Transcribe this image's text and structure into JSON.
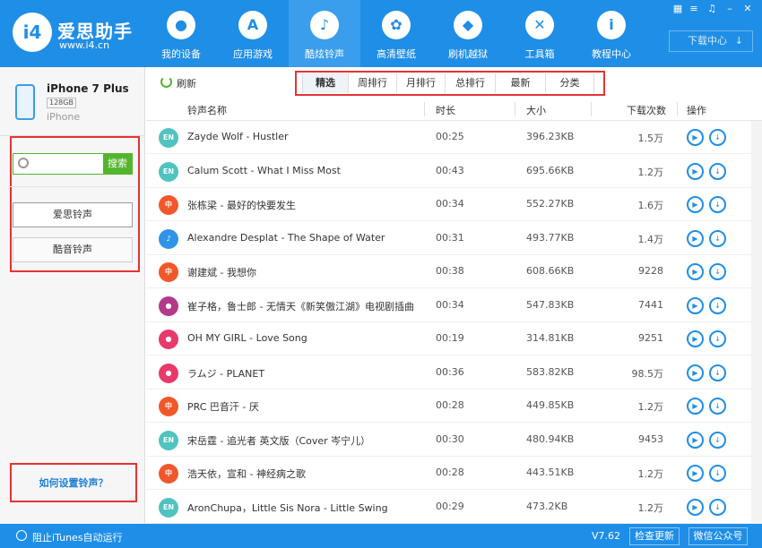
{
  "header": {
    "logo_text": "爱思助手",
    "logo_mark": "i4",
    "logo_url": "www.i4.cn",
    "nav": [
      {
        "label": "我的设备",
        "icon": "apple-icon",
        "glyph": ""
      },
      {
        "label": "应用游戏",
        "icon": "app-store-icon",
        "glyph": "A"
      },
      {
        "label": "酷炫铃声",
        "icon": "bell-icon",
        "glyph": "♪"
      },
      {
        "label": "高清壁纸",
        "icon": "flower-icon",
        "glyph": "✿"
      },
      {
        "label": "刷机越狱",
        "icon": "box-icon",
        "glyph": "◆"
      },
      {
        "label": "工具箱",
        "icon": "tools-icon",
        "glyph": "✕"
      },
      {
        "label": "教程中心",
        "icon": "info-icon",
        "glyph": "i"
      }
    ],
    "download_center": "下载中心"
  },
  "device": {
    "name": "iPhone 7 Plus",
    "capacity": "128GB",
    "type": "iPhone"
  },
  "sidebar": {
    "search_placeholder": "",
    "search_button": "搜索",
    "buttons": [
      "爱思铃声",
      "酷音铃声"
    ],
    "howto": "如何设置铃声？"
  },
  "toolbar": {
    "refresh": "刷新",
    "tabs": [
      "精选",
      "周排行",
      "月排行",
      "总排行",
      "最新",
      "分类"
    ]
  },
  "table": {
    "headers": {
      "name": "铃声名称",
      "duration": "时长",
      "size": "大小",
      "downloads": "下载次数",
      "ops": "操作"
    },
    "rows": [
      {
        "badge": "EN",
        "color": "#4fc3c0",
        "name": "Zayde Wolf - Hustler",
        "duration": "00:25",
        "size": "396.23KB",
        "downloads": "1.5万"
      },
      {
        "badge": "EN",
        "color": "#4fc3c0",
        "name": "Calum Scott - What I Miss Most",
        "duration": "00:43",
        "size": "695.66KB",
        "downloads": "1.2万"
      },
      {
        "badge": "中",
        "color": "#f0582c",
        "name": "张栋梁 - 最好的快要发生",
        "duration": "00:34",
        "size": "552.27KB",
        "downloads": "1.6万"
      },
      {
        "badge": "♪",
        "color": "#2f94e8",
        "name": "Alexandre Desplat - The Shape of Water",
        "duration": "00:31",
        "size": "493.77KB",
        "downloads": "1.4万"
      },
      {
        "badge": "中",
        "color": "#f0582c",
        "name": "谢建斌 - 我想你",
        "duration": "00:38",
        "size": "608.66KB",
        "downloads": "9228"
      },
      {
        "badge": "●",
        "color": "#b23a8a",
        "name": "崔子格，鲁士郎 - 无情天《新笑傲江湖》电视剧插曲",
        "duration": "00:34",
        "size": "547.83KB",
        "downloads": "7441"
      },
      {
        "badge": "●",
        "color": "#e83a6a",
        "name": "OH MY GIRL - Love Song",
        "duration": "00:19",
        "size": "314.81KB",
        "downloads": "9251"
      },
      {
        "badge": "●",
        "color": "#e83a6a",
        "name": "ラムジ - PLANET",
        "duration": "00:36",
        "size": "583.82KB",
        "downloads": "98.5万"
      },
      {
        "badge": "中",
        "color": "#f0582c",
        "name": "PRC 巴音汗 - 厌",
        "duration": "00:28",
        "size": "449.85KB",
        "downloads": "1.2万"
      },
      {
        "badge": "EN",
        "color": "#4fc3c0",
        "name": "宋岳霆 - 追光者 英文版（Cover 岑宁儿）",
        "duration": "00:30",
        "size": "480.94KB",
        "downloads": "9453"
      },
      {
        "badge": "中",
        "color": "#f0582c",
        "name": "浩天依，宣和 - 神经病之歌",
        "duration": "00:28",
        "size": "443.51KB",
        "downloads": "1.2万"
      },
      {
        "badge": "EN",
        "color": "#4fc3c0",
        "name": "AronChupa，Little Sis Nora - Little Swing",
        "duration": "00:29",
        "size": "473.2KB",
        "downloads": "1.2万"
      }
    ]
  },
  "footer": {
    "itunes_toggle": "阻止iTunes自动运行",
    "version": "V7.62",
    "check_update": "检查更新",
    "wechat": "微信公众号"
  }
}
